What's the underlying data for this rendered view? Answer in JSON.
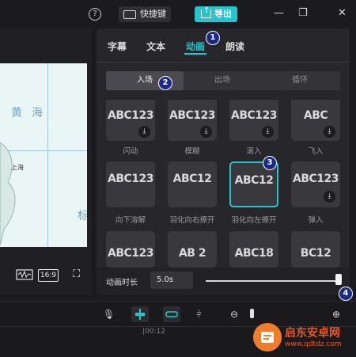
{
  "titlebar": {
    "help_icon": "?",
    "shortcut_label": "快捷键",
    "export_label": "导出",
    "minimize": "—",
    "maximize": "❐",
    "close": "✕"
  },
  "preview": {
    "map_labels": [
      "黄",
      "海",
      "上海",
      "标"
    ],
    "ratio": "16:9"
  },
  "panel": {
    "tabs": [
      "字幕",
      "文本",
      "动画",
      "朗读"
    ],
    "active_tab": "动画",
    "subtabs": [
      "入场",
      "出场",
      "循环"
    ],
    "active_subtab": "入场",
    "grid": [
      {
        "text": "ABC123",
        "label": "闪动",
        "download": true
      },
      {
        "text": "ABC123",
        "label": "模糊",
        "download": true
      },
      {
        "text": "ABC123",
        "label": "滚入",
        "download": true
      },
      {
        "text": "ABC",
        "label": "飞入",
        "download": true
      },
      {
        "text": "ABC123",
        "label": "向下溶解",
        "download": false
      },
      {
        "text": "ABC12",
        "label": "羽化向右擦开",
        "download": false
      },
      {
        "text": "ABC12",
        "label": "羽化向左擦开",
        "download": false,
        "selected": true
      },
      {
        "text": "ABC123",
        "label": "弹入",
        "download": true
      },
      {
        "text": "ABC123",
        "label": "",
        "download": false
      },
      {
        "text": "AB 2",
        "label": "",
        "download": false
      },
      {
        "text": "ABC18",
        "label": "",
        "download": false
      },
      {
        "text": "BC12",
        "label": "",
        "download": false
      }
    ],
    "duration_label": "动画时长",
    "duration_value": "5.0s",
    "duration_fraction": 1.0
  },
  "markers": [
    "1",
    "2",
    "3",
    "4"
  ],
  "timeline": {
    "tick": "|00:12"
  },
  "watermark": {
    "title": "启东安卓网",
    "url": "www.qdtdz.com"
  }
}
